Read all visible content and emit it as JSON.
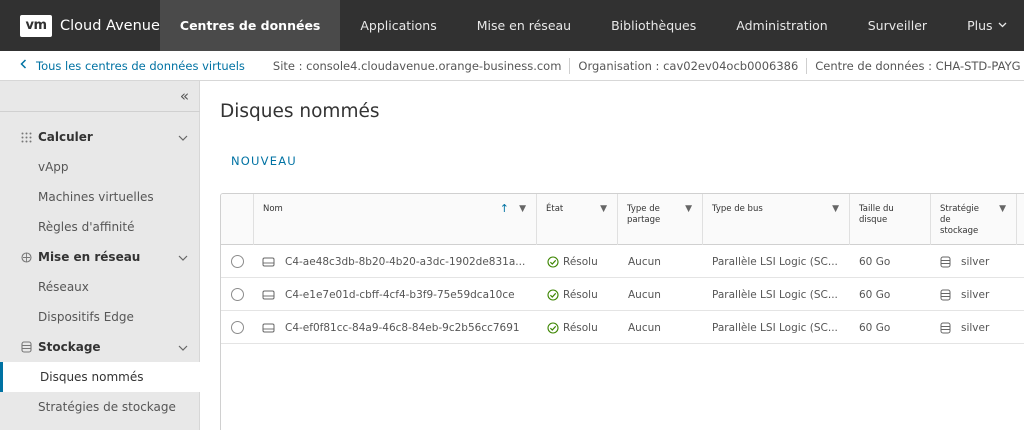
{
  "brand": {
    "logo": "vm",
    "name": "Cloud Avenue"
  },
  "nav": {
    "tabs": [
      "Centres de données",
      "Applications",
      "Mise en réseau",
      "Bibliothèques",
      "Administration",
      "Surveiller",
      "Plus"
    ],
    "active": "Centres de données"
  },
  "subbar": {
    "back_label": "Tous les centres de données virtuels",
    "site": "Site : console4.cloudavenue.orange-business.com",
    "organisation": "Organisation : cav02ev04ocb0006386",
    "datacenter": "Centre de données : CHA-STD-PAYG"
  },
  "sidebar": {
    "collapse_glyph": "«",
    "sections": [
      {
        "label": "Calculer",
        "icon": "grid-icon",
        "items": [
          "vApp",
          "Machines virtuelles",
          "Règles d'affinité"
        ]
      },
      {
        "label": "Mise en réseau",
        "icon": "network-icon",
        "items": [
          "Réseaux",
          "Dispositifs Edge"
        ]
      },
      {
        "label": "Stockage",
        "icon": "storage-icon",
        "items": [
          "Disques nommés",
          "Stratégies de stockage"
        ]
      }
    ],
    "active_item": "Disques nommés"
  },
  "main": {
    "title": "Disques nommés",
    "new_button": "NOUVEAU",
    "columns": {
      "name": "Nom",
      "state": "État",
      "share_type": "Type de partage",
      "bus_type": "Type de bus",
      "disk_size": "Taille du disque",
      "storage_policy": "Stratégie de stockage"
    },
    "rows": [
      {
        "name": "C4-ae48c3db-8b20-4b20-a3dc-1902de831a...",
        "state": "Résolu",
        "share_type": "Aucun",
        "bus_type": "Parallèle LSI Logic (SC...",
        "disk_size": "60 Go",
        "storage_policy": "silver"
      },
      {
        "name": "C4-e1e7e01d-cbff-4cf4-b3f9-75e59dca10ce",
        "state": "Résolu",
        "share_type": "Aucun",
        "bus_type": "Parallèle LSI Logic (SC...",
        "disk_size": "60 Go",
        "storage_policy": "silver"
      },
      {
        "name": "C4-ef0f81cc-84a9-46c8-84eb-9c2b56cc7691",
        "state": "Résolu",
        "share_type": "Aucun",
        "bus_type": "Parallèle LSI Logic (SC...",
        "disk_size": "60 Go",
        "storage_policy": "silver"
      }
    ]
  },
  "colors": {
    "topnav": "#313131",
    "accent": "#0072a3",
    "success": "#3c8500",
    "sidebar": "#e8e8e8"
  }
}
